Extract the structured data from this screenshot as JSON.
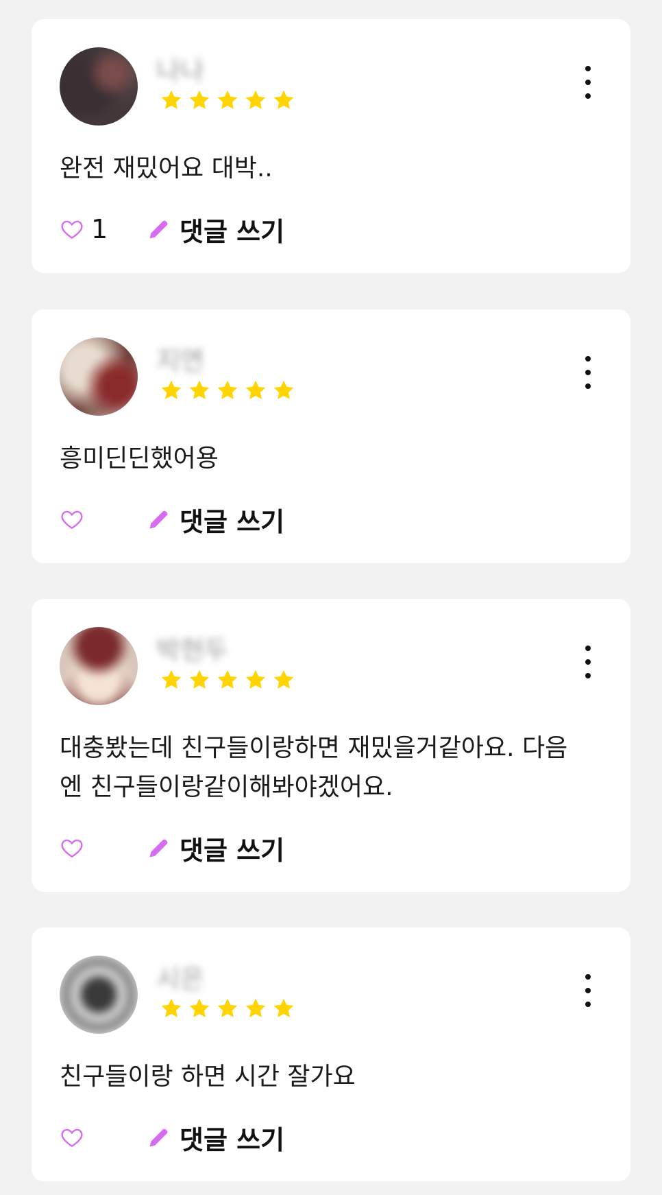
{
  "colors": {
    "background": "#f2f2f2",
    "card": "#ffffff",
    "star": "#ffd400",
    "accent": "#d66df0",
    "text": "#1a1a1a"
  },
  "icons": {
    "star": "star-icon",
    "more": "more-vertical-icon",
    "heart": "heart-outline-icon",
    "pencil": "pencil-icon"
  },
  "reviews": [
    {
      "username": "나나",
      "rating": 5,
      "text": "완전 재밌어요 대박..",
      "like_count": "1",
      "comment_label": "댓글 쓰기"
    },
    {
      "username": "지연",
      "rating": 5,
      "text": "흥미딘딘했어용",
      "like_count": "",
      "comment_label": "댓글 쓰기"
    },
    {
      "username": "박현두",
      "rating": 5,
      "text": "대충봤는데 친구들이랑하면 재밌을거같아요. 다음\n엔 친구들이랑같이해봐야겠어요.",
      "like_count": "",
      "comment_label": "댓글 쓰기"
    },
    {
      "username": "시은",
      "rating": 5,
      "text": "친구들이랑 하면 시간 잘가요",
      "like_count": "",
      "comment_label": "댓글 쓰기"
    }
  ]
}
